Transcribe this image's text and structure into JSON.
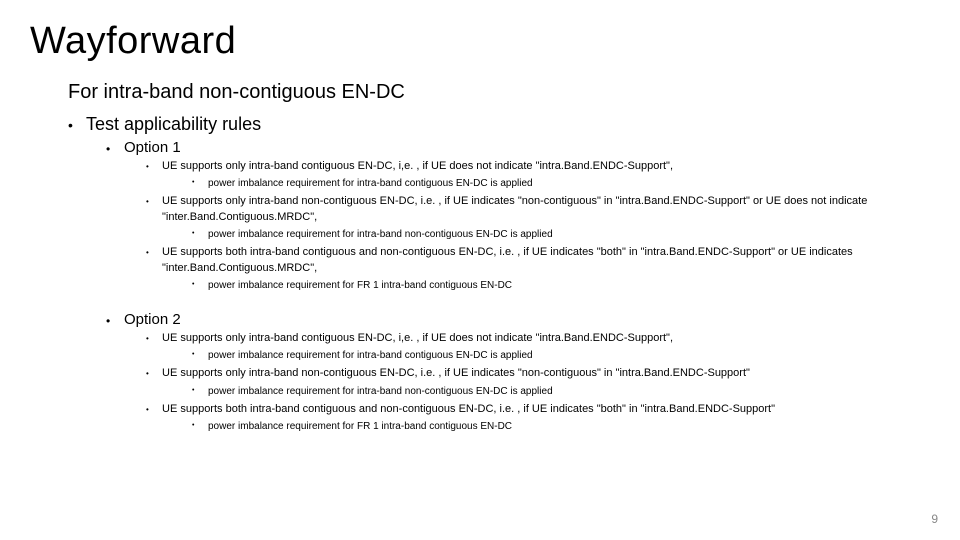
{
  "title": "Wayforward",
  "subtitle": "For intra-band non-contiguous EN-DC",
  "l1_0": "Test applicability rules",
  "opt1_label": "Option 1",
  "opt1_b0": "UE supports only intra-band contiguous EN-DC, i,e. , if UE does not indicate \"intra.Band.ENDC-Support\",",
  "opt1_b0_s": "power imbalance requirement for intra-band contiguous EN-DC is applied",
  "opt1_b1": "UE supports only intra-band non-contiguous EN-DC, i.e. , if UE indicates \"non-contiguous\" in \"intra.Band.ENDC-Support\" or UE does not indicate \"inter.Band.Contiguous.MRDC\",",
  "opt1_b1_s": "power imbalance requirement for intra-band non-contiguous EN-DC is applied",
  "opt1_b2": "UE supports both intra-band contiguous and non-contiguous EN-DC, i.e. , if UE indicates \"both\" in \"intra.Band.ENDC-Support\" or UE indicates \"inter.Band.Contiguous.MRDC\",",
  "opt1_b2_s": "power imbalance requirement for FR 1 intra-band contiguous EN-DC",
  "opt2_label": "Option 2",
  "opt2_b0": "UE supports only intra-band contiguous EN-DC, i,e. , if UE does not indicate \"intra.Band.ENDC-Support\",",
  "opt2_b0_s": "power imbalance requirement for intra-band contiguous EN-DC is applied",
  "opt2_b1": "UE supports only intra-band non-contiguous EN-DC, i.e. , if UE indicates \"non-contiguous\" in \"intra.Band.ENDC-Support\"",
  "opt2_b1_s": "power imbalance requirement for intra-band non-contiguous EN-DC is applied",
  "opt2_b2": "UE supports both intra-band contiguous and non-contiguous EN-DC, i.e. , if UE indicates \"both\" in \"intra.Band.ENDC-Support\"",
  "opt2_b2_s": "power imbalance requirement for FR 1 intra-band contiguous EN-DC",
  "page_number": "9"
}
